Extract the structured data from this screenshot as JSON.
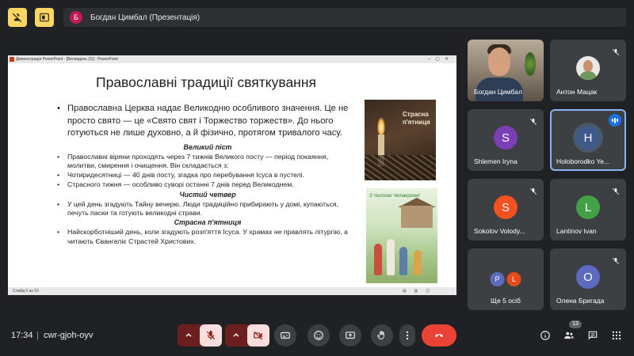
{
  "header": {
    "presenter_initial": "Б",
    "presenter_label": "Богдан Цимбал (Презентація)"
  },
  "presentation": {
    "window_title": "Демонстрація PowerPoint - [Великдень (2)] - PowerPoint",
    "status_left": "Слайд 5 из 10",
    "title": "Православні традиції святкування",
    "intro": "Православна Церква надає Великодню особливого значення. Це не просто свято — це «Свято свят і Торжество торжеств». До нього готуються не лише духовно, а й фізично, протягом тривалого часу.",
    "sections": [
      {
        "heading": "Великий піст",
        "bullets": [
          "Православні віряни проходять через 7 тижнів Великого посту — період покаяння, молитви, смирення і очищення. Він складається з:",
          "Чотиридесятниці — 40 днів посту, згадка про перебування Ісуса в пустелі.",
          "Страсного тижня — особливо суворі останні 7 днів перед Великоднем."
        ]
      },
      {
        "heading": "Чистий четвер",
        "bullets": [
          "У цей день згадують Тайну вечерю. Люди традиційно прибирають у домі, купаються, печуть паски та готують великодні страви."
        ]
      },
      {
        "heading": "Страсна п'ятниця",
        "bullets": [
          "Найскорботніший день, коли згадують розп'яття Ісуса. У храмах не правлять літургію, а читають Євангеліє Страстей Христових."
        ]
      }
    ],
    "image1_caption": "Страсна п'ятниця",
    "image2_caption": "З Чистим Четвергом!"
  },
  "participants": [
    {
      "name": "Богдан Цимбал",
      "type": "video",
      "muted": false
    },
    {
      "name": "Антон Мацак",
      "type": "photo",
      "muted": true
    },
    {
      "name": "Shlemen Iryna",
      "initial": "S",
      "color": "#7b3fb5",
      "muted": true
    },
    {
      "name": "Holoborodko Ye...",
      "initial": "H",
      "color": "#3f5a8a",
      "speaking": true
    },
    {
      "name": "Sokolov Volody...",
      "initial": "S",
      "color": "#f4511e",
      "muted": true
    },
    {
      "name": "Lantinov Ivan",
      "initial": "L",
      "color": "#43a047",
      "muted": true
    },
    {
      "name": "Ще 5 осіб",
      "type": "group",
      "initials": [
        "P",
        "L"
      ],
      "colors": [
        "#5c6bc0",
        "#e64a19"
      ]
    },
    {
      "name": "Олена Бригада",
      "initial": "О",
      "color": "#5c6bc0",
      "muted": true
    }
  ],
  "footer": {
    "time": "17:34",
    "separator": "|",
    "meeting_code": "cwr-gjoh-oyv",
    "people_count": "13"
  },
  "colors": {
    "accent_yellow": "#fdd663",
    "hangup_red": "#ea4335",
    "speaking_blue": "#8ab4f8"
  }
}
